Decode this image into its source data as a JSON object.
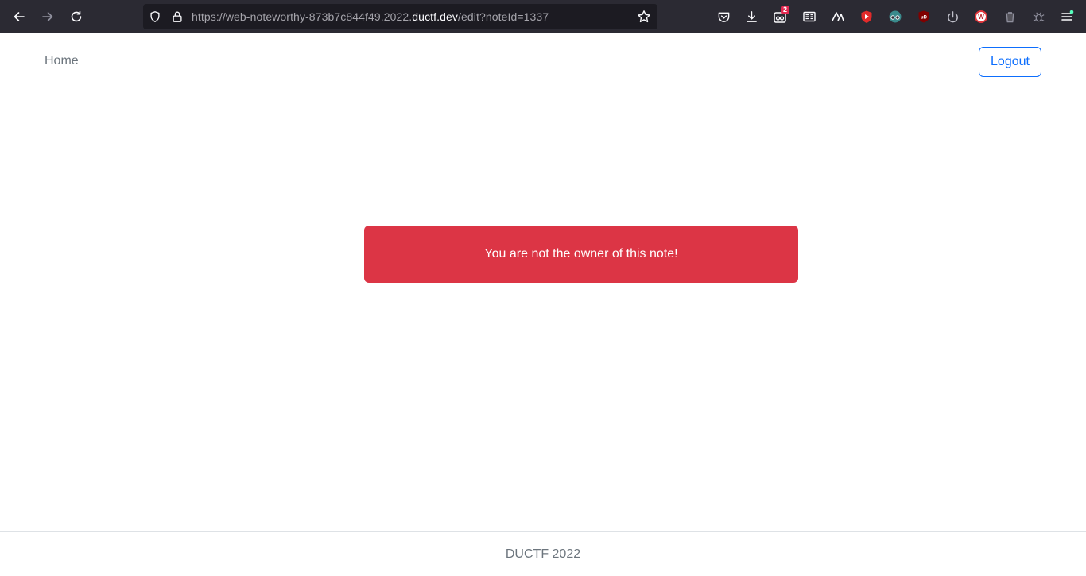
{
  "browser": {
    "url_prefix": "https://web-noteworthy-873b7c844f49.2022.",
    "url_domain": "ductf.dev",
    "url_suffix": "/edit?noteId=1337",
    "extension_badge": "2"
  },
  "navbar": {
    "home_label": "Home",
    "logout_label": "Logout"
  },
  "alert": {
    "message": "You are not the owner of this note!",
    "color": "#dc3545"
  },
  "footer": {
    "text": "DUCTF 2022"
  },
  "colors": {
    "primary": "#0d6efd",
    "muted": "#6c757d",
    "danger": "#dc3545"
  }
}
